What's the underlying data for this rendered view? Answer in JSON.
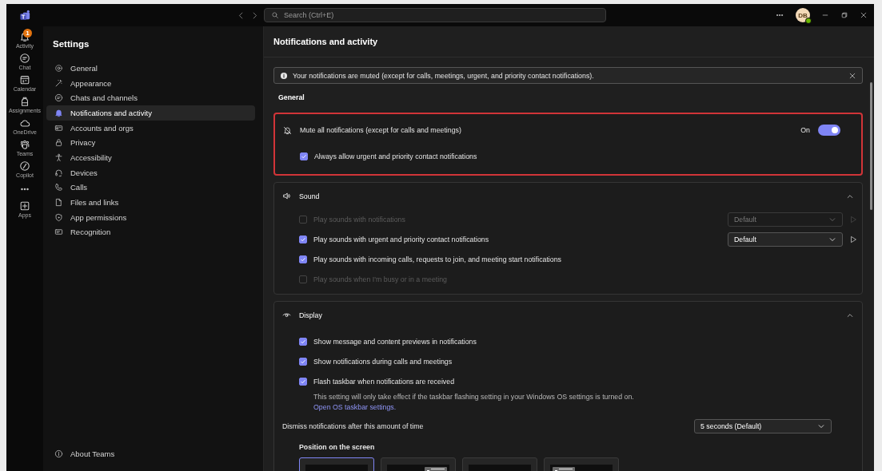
{
  "titlebar": {
    "search_placeholder": "Search (Ctrl+E)",
    "avatar_initials": "DB"
  },
  "rail": [
    {
      "label": "Activity",
      "badge": "1"
    },
    {
      "label": "Chat"
    },
    {
      "label": "Calendar"
    },
    {
      "label": "Assignments"
    },
    {
      "label": "OneDrive"
    },
    {
      "label": "Teams"
    },
    {
      "label": "Copilot"
    },
    {
      "kind": "more"
    },
    {
      "label": "Apps"
    }
  ],
  "settings_nav": {
    "title": "Settings",
    "items": [
      {
        "label": "General",
        "selected": false
      },
      {
        "label": "Appearance",
        "selected": false
      },
      {
        "label": "Chats and channels",
        "selected": false
      },
      {
        "label": "Notifications and activity",
        "selected": true
      },
      {
        "label": "Accounts and orgs",
        "selected": false
      },
      {
        "label": "Privacy",
        "selected": false
      },
      {
        "label": "Accessibility",
        "selected": false
      },
      {
        "label": "Devices",
        "selected": false
      },
      {
        "label": "Calls",
        "selected": false
      },
      {
        "label": "Files and links",
        "selected": false
      },
      {
        "label": "App permissions",
        "selected": false
      },
      {
        "label": "Recognition",
        "selected": false
      }
    ],
    "footer": {
      "label": "About Teams"
    }
  },
  "page": {
    "title": "Notifications and activity",
    "banner": {
      "text": "Your notifications are muted (except for calls, meetings, urgent, and priority contact notifications)."
    },
    "general_heading": "General",
    "mute_card": {
      "label": "Mute all notifications (except for calls and meetings)",
      "state_text": "On",
      "on": true,
      "highlighted": true,
      "option": {
        "label": "Always allow urgent and priority contact notifications",
        "checked": true
      }
    },
    "sound": {
      "title": "Sound",
      "expanded": true,
      "rows": [
        {
          "label": "Play sounds with notifications",
          "checked": false,
          "disabled": true,
          "dropdown": {
            "value": "Default",
            "disabled": true
          }
        },
        {
          "label": "Play sounds with urgent and priority contact notifications",
          "checked": true,
          "disabled": false,
          "dropdown": {
            "value": "Default",
            "disabled": false
          }
        },
        {
          "label": "Play sounds with incoming calls, requests to join, and meeting start notifications",
          "checked": true,
          "disabled": false
        },
        {
          "label": "Play sounds when I'm busy or in a meeting",
          "checked": false,
          "disabled": true
        }
      ]
    },
    "display": {
      "title": "Display",
      "expanded": true,
      "rows": [
        {
          "label": "Show message and content previews in notifications",
          "checked": true,
          "disabled": false
        },
        {
          "label": "Show notifications during calls and meetings",
          "checked": true,
          "disabled": false
        },
        {
          "label": "Flash taskbar when notifications are received",
          "checked": true,
          "disabled": false,
          "description": "This setting will only take effect if the taskbar flashing setting in your Windows OS settings is turned on.",
          "link": "Open OS taskbar settings."
        }
      ],
      "dismiss": {
        "label": "Dismiss notifications after this amount of time",
        "value": "5 seconds (Default)"
      },
      "position": {
        "label": "Position on the screen",
        "options": [
          {
            "kind": "bottom-right",
            "selected": true
          },
          {
            "kind": "top-right",
            "selected": false
          },
          {
            "kind": "bottom-left",
            "selected": false
          },
          {
            "kind": "top-left",
            "selected": false
          }
        ]
      }
    }
  }
}
